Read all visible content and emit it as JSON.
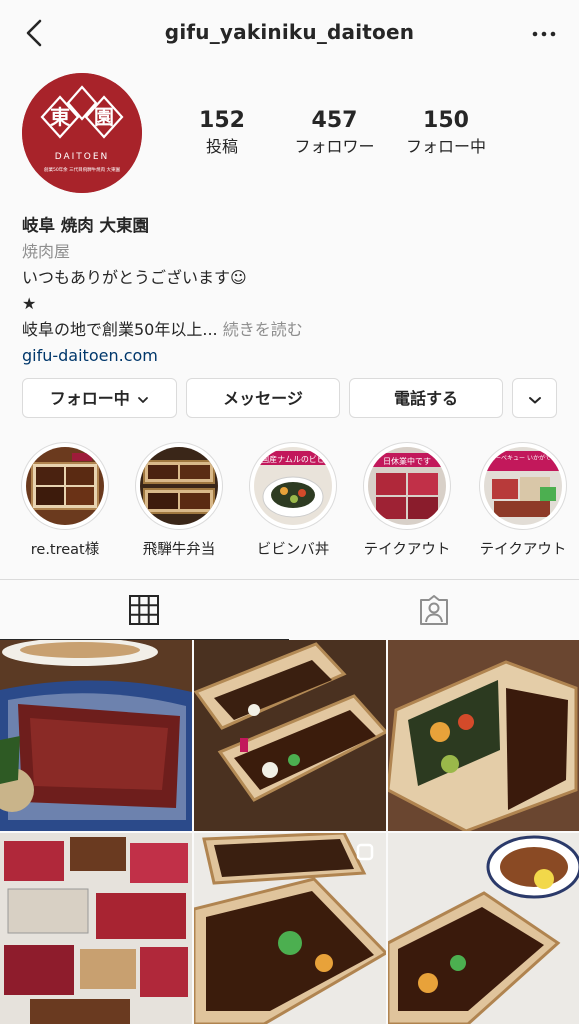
{
  "header": {
    "username": "gifu_yakiniku_daitoen",
    "back_icon": "chevron-left-icon",
    "more_icon": "more-horizontal-icon"
  },
  "profile": {
    "logo_text": "DAITOEN",
    "logo_subtext": "創業50年余 三代目飛騨牛焼肉 大東園",
    "logo_kanji": [
      "東",
      "園"
    ],
    "stats": [
      {
        "value": "152",
        "label": "投稿"
      },
      {
        "value": "457",
        "label": "フォロワー"
      },
      {
        "value": "150",
        "label": "フォロー中"
      }
    ],
    "name": "岐阜 焼肉 大東園",
    "category": "焼肉屋",
    "bio_line1": "いつもありがとうございます☺",
    "bio_line2": "★",
    "bio_line3": "岐阜の地で創業50年以上...",
    "bio_more": "続きを読む",
    "website": "gifu-daitoen.com"
  },
  "actions": {
    "follow_label": "フォロー中",
    "message_label": "メッセージ",
    "call_label": "電話する"
  },
  "highlights": [
    {
      "label": "re.treat様"
    },
    {
      "label": "飛騨牛弁当"
    },
    {
      "label": "ビビンバ丼",
      "overlay_text": "国産ナムルのビビ"
    },
    {
      "label": "テイクアウト",
      "overlay_text": "日休業中です"
    },
    {
      "label": "テイクアウト",
      "overlay_text": "お家でバーベキュー いかがでしょうか"
    }
  ],
  "tabs": {
    "grid_icon": "grid-icon",
    "tagged_icon": "tagged-person-icon"
  },
  "colors": {
    "brand_red": "#a8232a",
    "link": "#00376b",
    "muted": "#8e8e8e"
  }
}
